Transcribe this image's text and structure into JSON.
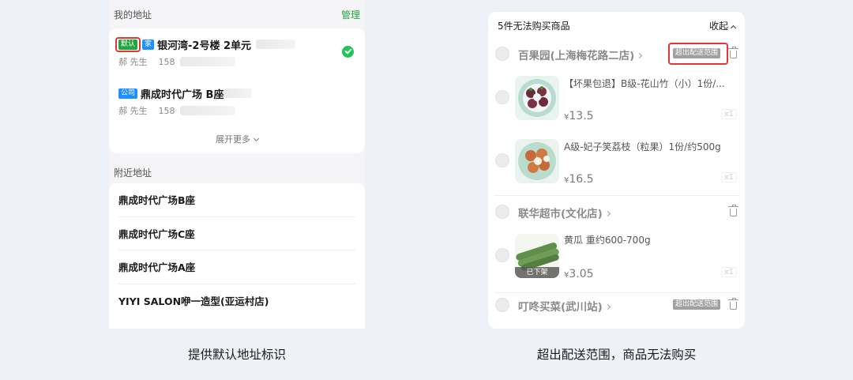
{
  "left": {
    "my_address_title": "我的地址",
    "manage_label": "管理",
    "addresses": [
      {
        "tags": [
          "默认",
          "家"
        ],
        "address": "银河湾-2号楼 2单元",
        "person": "郝 先生",
        "phone": "158",
        "selected": true
      },
      {
        "tags": [
          "公司"
        ],
        "address": "鼎成时代广场 B座",
        "person": "郝 先生",
        "phone": "158",
        "selected": false
      }
    ],
    "expand_label": "展开更多",
    "nearby_title": "附近地址",
    "nearby": [
      "鼎成时代广场B座",
      "鼎成时代广场C座",
      "鼎成时代广场A座",
      "YIYI SALON咿一造型(亚运村店)"
    ]
  },
  "right": {
    "header": "5件无法购买商品",
    "collapse_label": "收起",
    "out_of_range_label": "超出配送范围",
    "stores": [
      {
        "name": "百果园(上海梅花路二店)",
        "out_of_range": true,
        "products": [
          {
            "name": "【坏果包退】B级-花山竹（小）1份/...",
            "currency": "¥",
            "price": "13.5",
            "qty": "x1"
          },
          {
            "name": "A级-妃子笑荔枝（粒果）1份/约500g",
            "currency": "¥",
            "price": "16.5",
            "qty": "x1"
          }
        ]
      },
      {
        "name": "联华超市(文化店)",
        "out_of_range": false,
        "products": [
          {
            "name": "黄瓜  重约600-700g",
            "currency": "¥",
            "price": "3.05",
            "qty": "x1",
            "status": "已下架"
          }
        ]
      },
      {
        "name": "叮咚买菜(武川站)",
        "out_of_range": true,
        "products": []
      }
    ]
  },
  "captions": {
    "left": "提供默认地址标识",
    "right": "超出配送范围，商品无法购买"
  },
  "colors": {
    "accent_green": "#21a53c",
    "tag_blue": "#1e90ff",
    "highlight_red": "#e03636",
    "bg": "#eef2f8"
  }
}
